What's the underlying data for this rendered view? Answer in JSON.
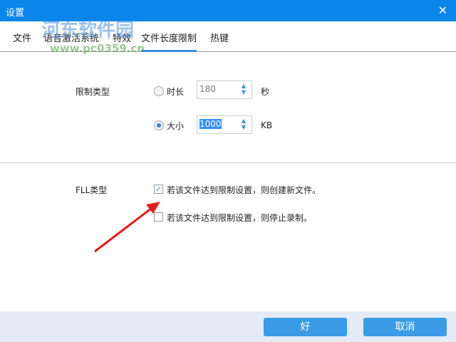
{
  "window": {
    "title": "设置",
    "close": "✕"
  },
  "tabs": [
    {
      "label": "文件"
    },
    {
      "label": "语音激活系统"
    },
    {
      "label": "特效"
    },
    {
      "label": "文件长度限制"
    },
    {
      "label": "热键"
    }
  ],
  "limit": {
    "label": "限制类型",
    "duration": {
      "label": "时长",
      "value": "180",
      "unit": "秒",
      "selected": false
    },
    "size": {
      "label": "大小",
      "value": "1000",
      "unit": "KB",
      "selected": true
    }
  },
  "fll": {
    "label": "FLL类型",
    "options": [
      {
        "label": "若该文件达到限制设置，则创建新文件。",
        "checked": true
      },
      {
        "label": "若该文件达到限制设置，则停止录制。",
        "checked": false
      }
    ]
  },
  "buttons": {
    "ok": "好",
    "cancel": "取消"
  },
  "watermark": {
    "name": "河东软件园",
    "url": "www.pc0359.cn"
  },
  "colors": {
    "titlebar": "#0a86ea",
    "button": "#3b9be6",
    "arrow": "#e02020"
  }
}
